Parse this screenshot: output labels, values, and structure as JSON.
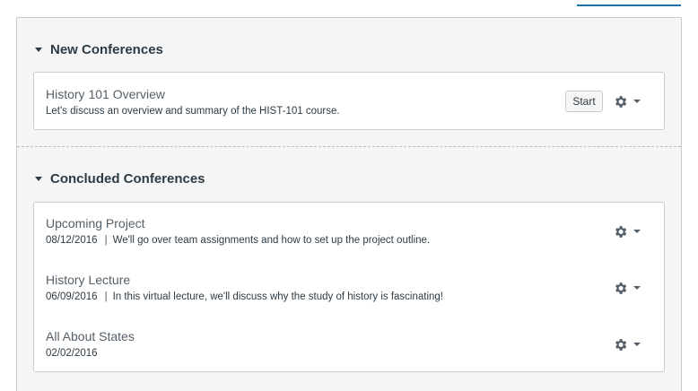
{
  "sections": {
    "new": {
      "title": "New Conferences",
      "items": [
        {
          "title": "History 101 Overview",
          "description": "Let's discuss an overview and summary of the HIST-101 course.",
          "action_label": "Start"
        }
      ]
    },
    "concluded": {
      "title": "Concluded Conferences",
      "items": [
        {
          "title": "Upcoming Project",
          "date": "08/12/2016",
          "separator": "|",
          "description": "We'll go over team assignments and how to set up the project outline."
        },
        {
          "title": "History Lecture",
          "date": "06/09/2016",
          "separator": "|",
          "description": "In this virtual lecture, we'll discuss why the study of history is fascinating!"
        },
        {
          "title": "All About States",
          "date": "02/02/2016"
        }
      ]
    }
  },
  "icons": {
    "section_toggle": "caret-down-icon",
    "settings": "gear-icon",
    "settings_menu": "chevron-down-icon"
  },
  "colors": {
    "text": "#2d3b45",
    "muted": "#55606a",
    "border": "#c7cdd1",
    "panel_bg": "#f5f5f5",
    "accent": "#1d6fa8"
  }
}
